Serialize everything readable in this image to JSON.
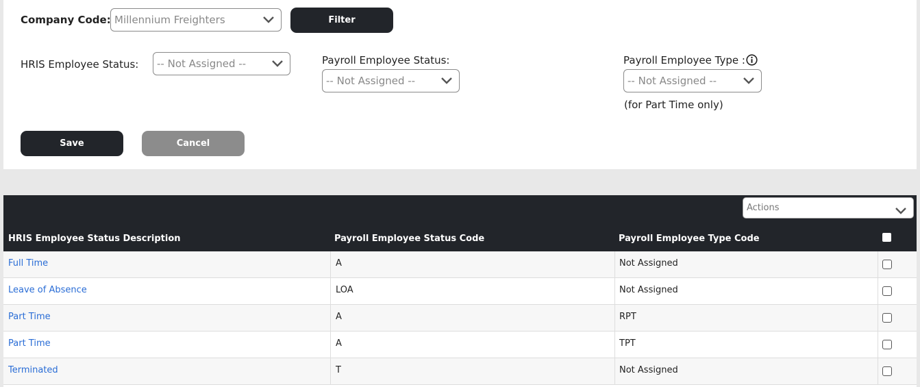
{
  "filter": {
    "company_code_label": "Company Code:",
    "company_code_value": "Millennium Freighters",
    "filter_button": "Filter"
  },
  "form": {
    "hris_status_label": "HRIS Employee Status:",
    "hris_status_value": "-- Not Assigned --",
    "payroll_status_label": "Payroll Employee Status:",
    "payroll_status_value": "-- Not Assigned --",
    "payroll_type_label": "Payroll Employee Type :",
    "payroll_type_value": "-- Not Assigned --",
    "payroll_type_note": "(for Part Time only)",
    "save_button": "Save",
    "cancel_button": "Cancel"
  },
  "grid": {
    "actions_placeholder": "Actions",
    "columns": [
      "HRIS Employee Status Description",
      "Payroll Employee Status Code",
      "Payroll Employee Type Code"
    ],
    "rows": [
      {
        "description": "Full Time",
        "status_code": "A",
        "type_code": "Not Assigned"
      },
      {
        "description": "Leave of Absence",
        "status_code": "LOA",
        "type_code": "Not Assigned"
      },
      {
        "description": "Part Time",
        "status_code": "A",
        "type_code": "RPT"
      },
      {
        "description": "Part Time",
        "status_code": "A",
        "type_code": "TPT"
      },
      {
        "description": "Terminated",
        "status_code": "T",
        "type_code": "Not Assigned"
      }
    ]
  },
  "icons": {
    "dropdown": "chevron-down-icon",
    "info": "info-icon"
  }
}
